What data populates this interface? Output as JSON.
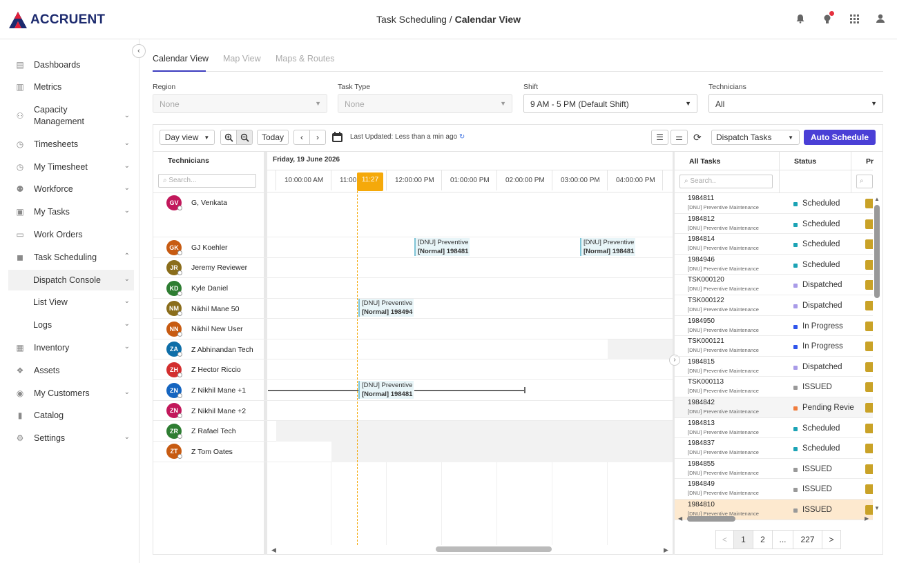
{
  "brand": {
    "name": "ACCRUENT"
  },
  "breadcrumb": {
    "parent": "Task Scheduling",
    "sep": "/",
    "current": "Calendar View"
  },
  "sidebar": {
    "items": [
      {
        "label": "Dashboards",
        "icon": "database-icon"
      },
      {
        "label": "Metrics",
        "icon": "bar-chart-icon"
      },
      {
        "label": "Capacity Management",
        "icon": "users-cog-icon"
      },
      {
        "label": "Timesheets",
        "icon": "stopwatch-icon"
      },
      {
        "label": "My Timesheet",
        "icon": "stopwatch-icon"
      },
      {
        "label": "Workforce",
        "icon": "group-icon"
      },
      {
        "label": "My Tasks",
        "icon": "clipboard-icon"
      },
      {
        "label": "Work Orders",
        "icon": "id-card-icon"
      },
      {
        "label": "Task Scheduling",
        "icon": "truck-icon"
      },
      {
        "label": "Dispatch Console",
        "icon": ""
      },
      {
        "label": "List View",
        "icon": ""
      },
      {
        "label": "Logs",
        "icon": ""
      },
      {
        "label": "Inventory",
        "icon": "boxes-icon"
      },
      {
        "label": "Assets",
        "icon": "cubes-icon"
      },
      {
        "label": "My Customers",
        "icon": "user-circle-icon"
      },
      {
        "label": "Catalog",
        "icon": "book-icon"
      },
      {
        "label": "Settings",
        "icon": "gear-icon"
      }
    ]
  },
  "tabs": [
    "Calendar View",
    "Map View",
    "Maps & Routes"
  ],
  "filters": {
    "region": {
      "label": "Region",
      "value": "None"
    },
    "task_type": {
      "label": "Task Type",
      "value": "None"
    },
    "shift": {
      "label": "Shift",
      "value": "9 AM - 5 PM (Default Shift)"
    },
    "technicians": {
      "label": "Technicians",
      "value": "All"
    }
  },
  "toolbar": {
    "day_view": "Day view",
    "today": "Today",
    "last_updated": "Last Updated: Less than a min ago",
    "dispatch_select": "Dispatch Tasks",
    "auto_schedule": "Auto Schedule"
  },
  "calendar": {
    "tech_header": "Technicians",
    "search_placeholder": "Search...",
    "date": "Friday, 19 June 2026",
    "ticks": [
      "10:00:00 AM",
      "11:00",
      "12:00:00 PM",
      "01:00:00 PM",
      "02:00:00 PM",
      "03:00:00 PM",
      "04:00:00 PM"
    ],
    "now": "11:27",
    "technicians": [
      {
        "initials": "GV",
        "name": "G, Venkata",
        "color": "#c2185b"
      },
      {
        "initials": "GK",
        "name": "GJ Koehler",
        "color": "#c75b12"
      },
      {
        "initials": "JR",
        "name": "Jeremy Reviewer",
        "color": "#8a6d1b"
      },
      {
        "initials": "KD",
        "name": "Kyle Daniel",
        "color": "#2e7d32"
      },
      {
        "initials": "NM",
        "name": "Nikhil Mane 50",
        "color": "#8a6d1b"
      },
      {
        "initials": "NN",
        "name": "Nikhil New User",
        "color": "#c75b12"
      },
      {
        "initials": "ZA",
        "name": "Z Abhinandan Tech",
        "color": "#0e6ea8"
      },
      {
        "initials": "ZH",
        "name": "Z Hector Riccio",
        "color": "#d32f2f"
      },
      {
        "initials": "ZN",
        "name": "Z Nikhil Mane +1",
        "color": "#1565c0"
      },
      {
        "initials": "ZN",
        "name": "Z Nikhil Mane +2",
        "color": "#c2185b"
      },
      {
        "initials": "ZR",
        "name": "Z Rafael Tech",
        "color": "#2e7d32"
      },
      {
        "initials": "ZT",
        "name": "Z Tom Oates",
        "color": "#c75b12"
      }
    ],
    "events": [
      {
        "line1": "[DNU] Preventive",
        "line2": "[Normal] 198481"
      },
      {
        "line1": "[DNU] Preventive",
        "line2": "[Normal] 198481"
      },
      {
        "line1": "[DNU] Preventive",
        "line2": "[Normal] 198494"
      },
      {
        "line1": "[DNU] Preventive",
        "line2": "[Normal] 198481"
      }
    ]
  },
  "tasks": {
    "col_all": "All Tasks",
    "col_status": "Status",
    "col_pr": "Pr",
    "search_placeholder": "Search..",
    "rows": [
      {
        "id": "1984811",
        "sub": "[DNU] Preventive Maintenance",
        "status": "Scheduled",
        "dot": "#1ba3b5"
      },
      {
        "id": "1984812",
        "sub": "[DNU] Preventive Maintenance",
        "status": "Scheduled",
        "dot": "#1ba3b5"
      },
      {
        "id": "1984814",
        "sub": "[DNU] Preventive Maintenance",
        "status": "Scheduled",
        "dot": "#1ba3b5"
      },
      {
        "id": "1984946",
        "sub": "[DNU] Preventive Maintenance",
        "status": "Scheduled",
        "dot": "#1ba3b5"
      },
      {
        "id": "TSK000120",
        "sub": "[DNU] Preventive Maintenance",
        "status": "Dispatched",
        "dot": "#a99be8"
      },
      {
        "id": "TSK000122",
        "sub": "[DNU] Preventive Maintenance",
        "status": "Dispatched",
        "dot": "#a99be8"
      },
      {
        "id": "1984950",
        "sub": "[DNU] Preventive Maintenance",
        "status": "In Progress",
        "dot": "#2f54eb"
      },
      {
        "id": "TSK000121",
        "sub": "[DNU] Preventive Maintenance",
        "status": "In Progress",
        "dot": "#2f54eb"
      },
      {
        "id": "1984815",
        "sub": "[DNU] Preventive Maintenance",
        "status": "Dispatched",
        "dot": "#a99be8"
      },
      {
        "id": "TSK000113",
        "sub": "[DNU] Preventive Maintenance",
        "status": "ISSUED",
        "dot": "#999999"
      },
      {
        "id": "1984842",
        "sub": "[DNU] Preventive Maintenance",
        "status": "Pending Revie",
        "dot": "#f07c3c"
      },
      {
        "id": "1984813",
        "sub": "[DNU] Preventive Maintenance",
        "status": "Scheduled",
        "dot": "#1ba3b5"
      },
      {
        "id": "1984837",
        "sub": "[DNU] Preventive Maintenance",
        "status": "Scheduled",
        "dot": "#1ba3b5"
      },
      {
        "id": "1984855",
        "sub": "[DNU] Preventive Maintenance",
        "status": "ISSUED",
        "dot": "#999999"
      },
      {
        "id": "1984849",
        "sub": "[DNU] Preventive Maintenance",
        "status": "ISSUED",
        "dot": "#999999"
      },
      {
        "id": "1984810",
        "sub": "[DNU] Preventive Maintenance",
        "status": "ISSUED",
        "dot": "#999999"
      }
    ]
  },
  "pagination": {
    "prev": "<",
    "pages": [
      "1",
      "2",
      "...",
      "227"
    ],
    "next": ">"
  },
  "colors": {
    "accent": "#4a3fd6",
    "now": "#f5a90a",
    "brand": "#1c2a6e"
  }
}
